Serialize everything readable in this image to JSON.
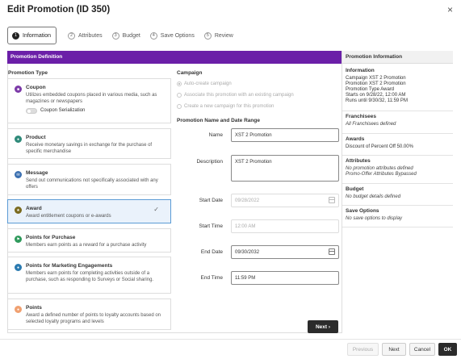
{
  "dialog": {
    "title": "Edit Promotion (ID 350)",
    "close_glyph": "×"
  },
  "steps": [
    {
      "num": "1",
      "label": "Information"
    },
    {
      "num": "2",
      "label": "Attributes"
    },
    {
      "num": "3",
      "label": "Budget"
    },
    {
      "num": "4",
      "label": "Save Options"
    },
    {
      "num": "5",
      "label": "Review"
    }
  ],
  "definition": {
    "header": "Promotion Definition",
    "type_title": "Promotion Type",
    "types": [
      {
        "title": "Coupon",
        "desc": "Utilizes embedded coupons placed in various media, such as magazines or newspapers",
        "icon": "ticket-icon",
        "color": "#7c3aa8"
      },
      {
        "title": "Product",
        "desc": "Receive monetary savings in exchange for the purchase of specific merchandise",
        "icon": "tag-icon",
        "color": "#2f8a7a"
      },
      {
        "title": "Message",
        "desc": "Send out communications not specifically associated with any offers",
        "icon": "message-icon",
        "color": "#3a6fb0"
      },
      {
        "title": "Award",
        "desc": "Award entitlement coupons or e-awards",
        "icon": "award-icon",
        "color": "#7a6a1e"
      },
      {
        "title": "Points for Purchase",
        "desc": "Members earn points as a reward for a purchase activity",
        "icon": "flag-icon",
        "color": "#2f9a5c"
      },
      {
        "title": "Points for Marketing Engagements",
        "desc": "Members earn points for completing activities outside of a purchase, such as responding to Surveys or Social sharing.",
        "icon": "engagement-icon",
        "color": "#2a7ab0"
      },
      {
        "title": "Points",
        "desc": "Award a defined number of points to loyalty accounts based on selected loyalty programs and levels",
        "icon": "points-icon",
        "color": "#f0a070"
      }
    ],
    "coupon_serialization_label": "Coupon Serialization",
    "selected_check": "✓"
  },
  "campaign": {
    "title": "Campaign",
    "options": [
      "Auto-create campaign",
      "Associate this promotion with an existing campaign",
      "Create a new campaign for this promotion"
    ]
  },
  "name_date": {
    "title": "Promotion Name and Date Range",
    "name_label": "Name",
    "name_value": "XST 2 Promotion",
    "description_label": "Description",
    "description_value": "XST 2 Promotion",
    "start_date_label": "Start Date",
    "start_date_value": "09/28/2022",
    "start_time_label": "Start Time",
    "start_time_value": "12:00 AM",
    "end_date_label": "End Date",
    "end_date_value": "09/30/2032",
    "end_time_label": "End Time",
    "end_time_value": "11:59 PM",
    "next_label": "Next",
    "next_glyph": "›"
  },
  "info_panel": {
    "header": "Promotion Information",
    "information_title": "Information",
    "information_lines": [
      "Campaign XST 2 Promotion",
      "Promotion XST 2 Promotion",
      "Promotion Type Award",
      "Starts on 9/28/22, 12:00 AM",
      "Runs until 9/30/32, 11:59 PM"
    ],
    "franchisees_title": "Franchisees",
    "franchisees_value": "All Franchisees defined",
    "awards_title": "Awards",
    "awards_value": "Discount of Percent Off 50.00%",
    "attributes_title": "Attributes",
    "attributes_lines": [
      "No promotion attributes defined",
      "Promo-Offer Attributes Bypassed"
    ],
    "budget_title": "Budget",
    "budget_value": "No budget details defined",
    "save_options_title": "Save Options",
    "save_options_value": "No save options to display"
  },
  "footer": {
    "previous": "Previous",
    "next": "Next",
    "cancel": "Cancel",
    "ok": "OK"
  }
}
